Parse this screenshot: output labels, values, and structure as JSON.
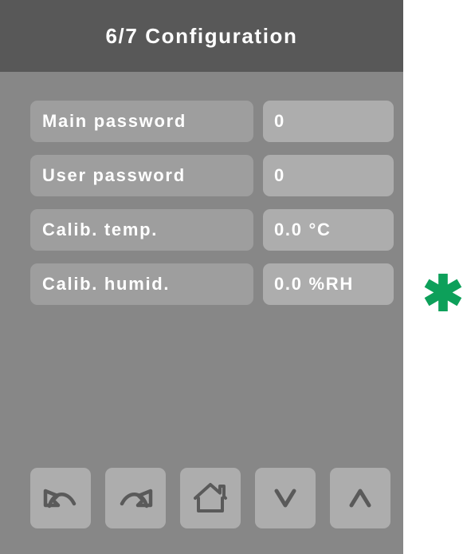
{
  "screen": {
    "title": "6/7 Configuration",
    "background_color": "#878787",
    "titlebar_color": "#585858",
    "label_pill_color": "#9e9e9e",
    "value_pill_color": "#adadad"
  },
  "settings": {
    "rows": [
      {
        "label": "Main password",
        "value": "0"
      },
      {
        "label": "User password",
        "value": "0"
      },
      {
        "label": "Calib. temp.",
        "value": "0.0 °C"
      },
      {
        "label": "Calib. humid.",
        "value": "0.0 %RH"
      }
    ]
  },
  "navigation": {
    "buttons": [
      {
        "icon": "undo-arrow-icon",
        "name": "undo-button"
      },
      {
        "icon": "redo-arrow-icon",
        "name": "redo-button"
      },
      {
        "icon": "home-icon",
        "name": "home-button"
      },
      {
        "icon": "chevron-down-icon",
        "name": "scroll-down-button"
      },
      {
        "icon": "chevron-up-icon",
        "name": "scroll-up-button"
      }
    ],
    "icon_color": "#5a5a5a"
  },
  "annotation": {
    "marker_glyph": "✱",
    "marker_color": "#0da05a"
  }
}
